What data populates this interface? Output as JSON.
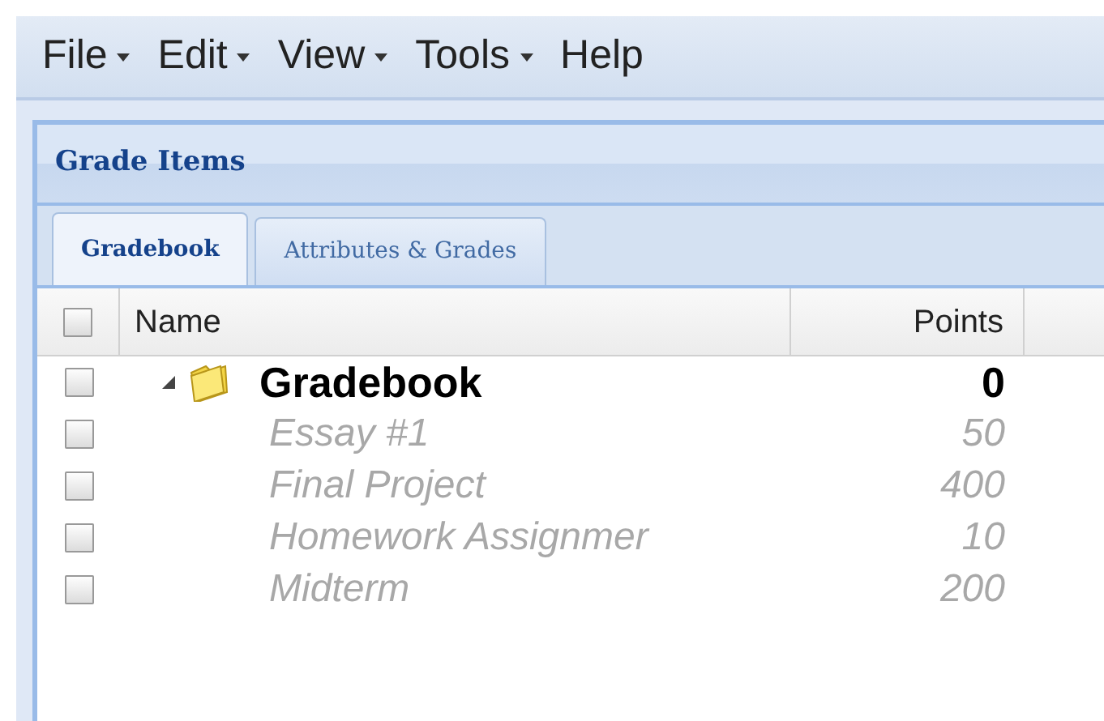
{
  "menu": [
    {
      "label": "File",
      "dropdown": true
    },
    {
      "label": "Edit",
      "dropdown": true
    },
    {
      "label": "View",
      "dropdown": true
    },
    {
      "label": "Tools",
      "dropdown": true
    },
    {
      "label": "Help",
      "dropdown": false
    }
  ],
  "panel": {
    "title": "Grade Items"
  },
  "tabs": [
    {
      "label": "Gradebook",
      "selected": true
    },
    {
      "label": "Attributes & Grades",
      "selected": false
    }
  ],
  "table": {
    "select_all": {
      "checked": false
    },
    "columns": [
      "Name",
      "Points"
    ],
    "rows": [
      {
        "kind": "category",
        "name": "Gradebook",
        "points": "0",
        "checked": false,
        "expanded": true
      },
      {
        "kind": "item",
        "name": "Essay #1",
        "points": "50",
        "checked": false
      },
      {
        "kind": "item",
        "name": "Final Project",
        "points": "400",
        "checked": false
      },
      {
        "kind": "item",
        "name": "Homework Assignmer",
        "points": "10",
        "checked": false
      },
      {
        "kind": "item",
        "name": "Midterm",
        "points": "200",
        "checked": false
      }
    ]
  }
}
